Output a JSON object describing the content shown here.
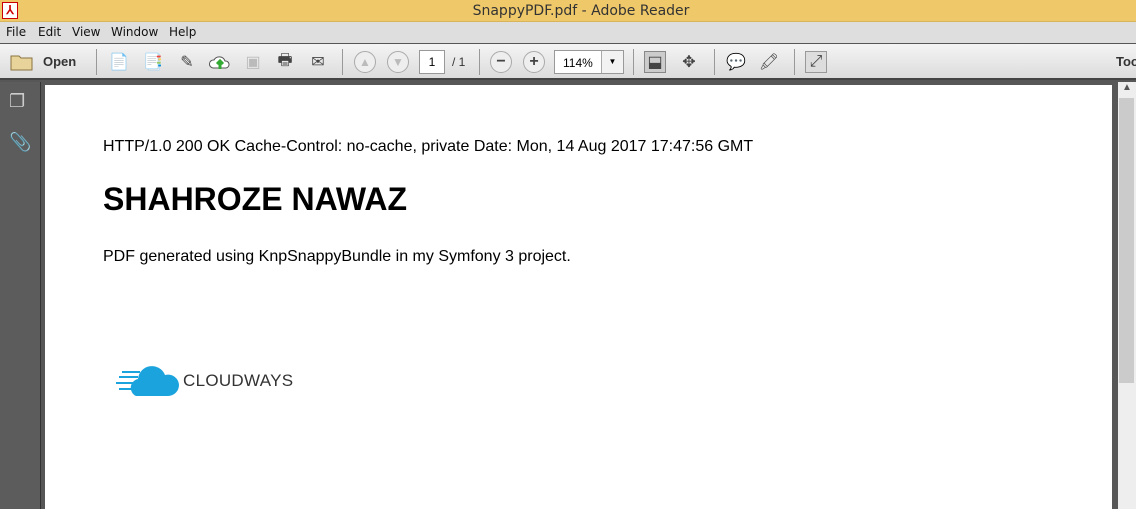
{
  "window": {
    "title": "SnappyPDF.pdf - Adobe Reader"
  },
  "menu": [
    "File",
    "Edit",
    "View",
    "Window",
    "Help"
  ],
  "toolbar": {
    "open_label": "Open",
    "page_current": "1",
    "page_total": "/ 1",
    "zoom": "114%",
    "tools_label": "Tools"
  },
  "document": {
    "header_line": "HTTP/1.0 200 OK Cache-Control: no-cache, private Date: Mon, 14 Aug 2017 17:47:56 GMT",
    "heading": "SHAHROZE NAWAZ",
    "body": "PDF generated using KnpSnappyBundle in my Symfony 3 project.",
    "logo_text": "CLOUDWAYS"
  },
  "colors": {
    "titlebar": "#efc86a",
    "logo_blue": "#1ba3dd"
  }
}
